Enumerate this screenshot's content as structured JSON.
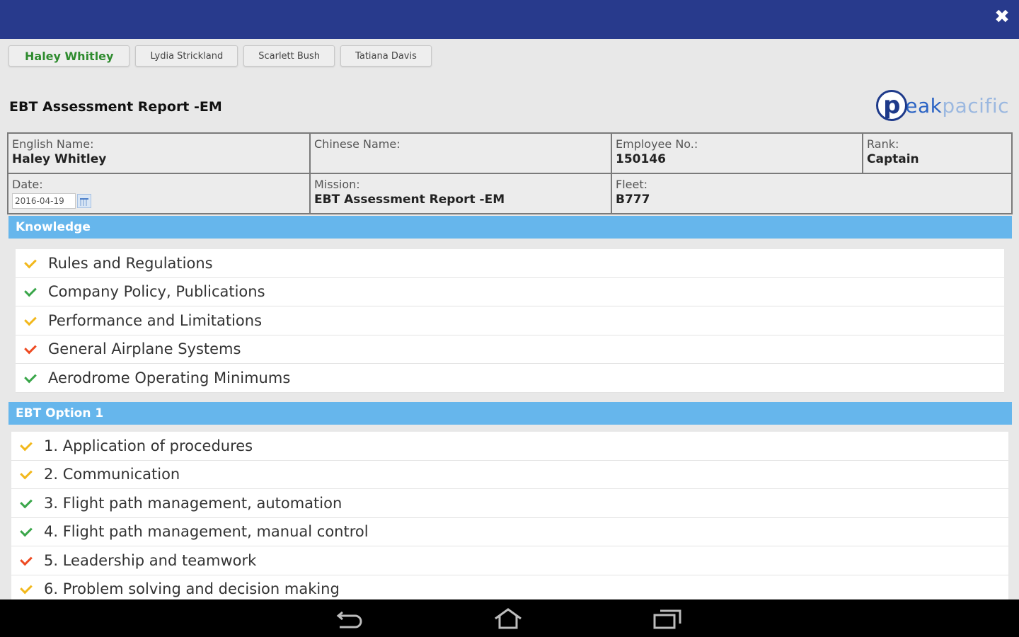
{
  "header": {
    "close_icon": "close-icon",
    "color": "#283a8c"
  },
  "tabs": [
    {
      "label": "Haley Whitley",
      "active": true
    },
    {
      "label": "Lydia Strickland",
      "active": false
    },
    {
      "label": "Scarlett Bush",
      "active": false
    },
    {
      "label": "Tatiana Davis",
      "active": false
    }
  ],
  "report": {
    "title": "EBT Assessment Report -EM"
  },
  "logo": {
    "mark": "p",
    "word_dark": "eak",
    "word_light": "pacific"
  },
  "info": {
    "english_name_label": "English Name:",
    "english_name": "Haley Whitley",
    "chinese_name_label": "Chinese Name:",
    "chinese_name": "",
    "employee_no_label": "Employee No.:",
    "employee_no": "150146",
    "rank_label": "Rank:",
    "rank": "Captain",
    "date_label": "Date:",
    "date": "2016-04-19",
    "mission_label": "Mission:",
    "mission": "EBT Assessment Report -EM",
    "fleet_label": "Fleet:",
    "fleet": "B777"
  },
  "sections": {
    "knowledge": {
      "title": "Knowledge",
      "items": [
        {
          "label": "Rules and Regulations",
          "status": "yellow"
        },
        {
          "label": "Company Policy, Publications",
          "status": "green"
        },
        {
          "label": "Performance and Limitations",
          "status": "yellow"
        },
        {
          "label": "General Airplane Systems",
          "status": "red"
        },
        {
          "label": "Aerodrome Operating Minimums",
          "status": "green"
        }
      ]
    },
    "ebt_option_1": {
      "title": "EBT Option 1",
      "items": [
        {
          "label": "1. Application of procedures",
          "status": "yellow"
        },
        {
          "label": "2. Communication",
          "status": "yellow"
        },
        {
          "label": "3. Flight path management, automation",
          "status": "green"
        },
        {
          "label": "4. Flight path management, manual control",
          "status": "green"
        },
        {
          "label": "5. Leadership and teamwork",
          "status": "red"
        },
        {
          "label": "6. Problem solving and decision making",
          "status": "yellow"
        }
      ]
    }
  },
  "colors": {
    "yellow": "#f2b81c",
    "green": "#3aa64a",
    "red": "#ee4b22",
    "section_header": "#66b6ec"
  },
  "navbar": {
    "buttons": [
      "back-icon",
      "home-icon",
      "recent-apps-icon"
    ]
  }
}
